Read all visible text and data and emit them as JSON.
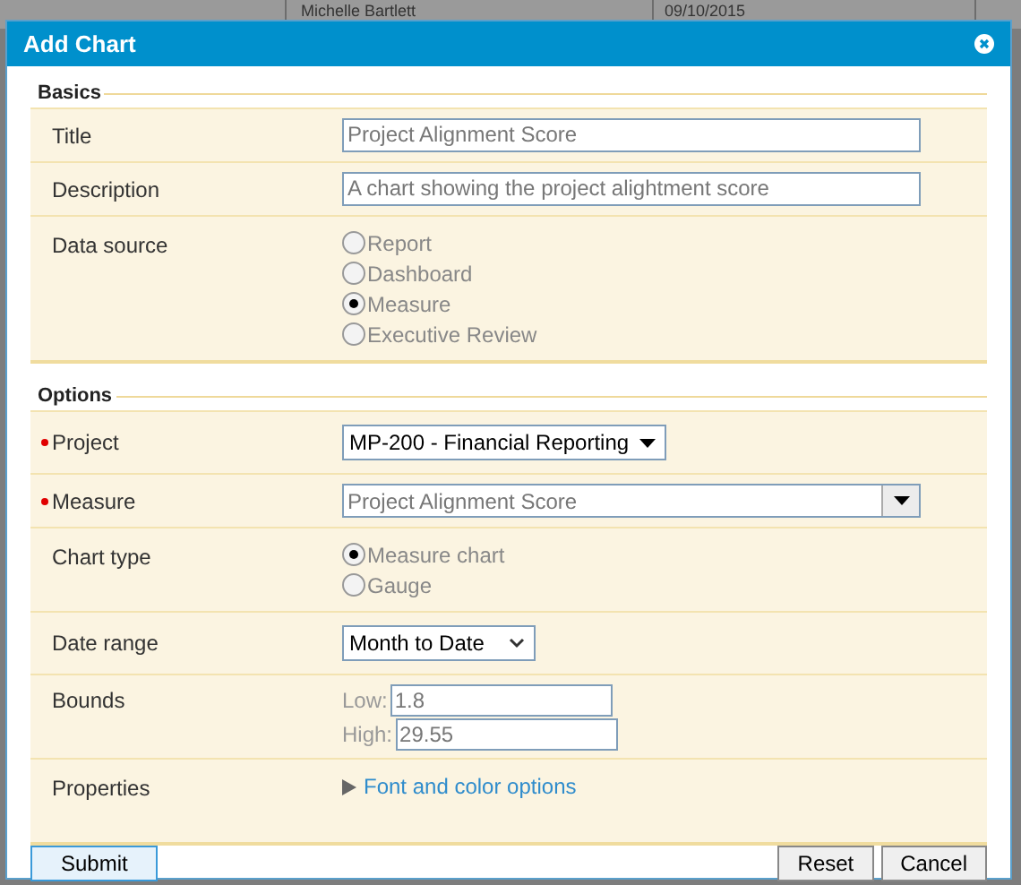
{
  "background_table": {
    "cells": [
      "Michelle Bartlett",
      "09/10/2015"
    ]
  },
  "dialog": {
    "title": "Add Chart"
  },
  "sections": [
    {
      "legend": "Basics",
      "rows": [
        {
          "kind": "text",
          "label": "Title",
          "required": false,
          "value": "Project Alignment Score"
        },
        {
          "kind": "text",
          "label": "Description",
          "required": false,
          "value": "A chart showing the project alightment score"
        },
        {
          "kind": "radio",
          "label": "Data source",
          "required": false,
          "options": [
            {
              "label": "Report",
              "selected": false
            },
            {
              "label": "Dashboard",
              "selected": false
            },
            {
              "label": "Measure",
              "selected": true
            },
            {
              "label": "Executive Review",
              "selected": false
            }
          ]
        }
      ]
    },
    {
      "legend": "Options",
      "rows": [
        {
          "kind": "select",
          "label": "Project",
          "required": true,
          "value": "MP-200 - Financial Reporting"
        },
        {
          "kind": "combo",
          "label": "Measure",
          "required": true,
          "value": "Project Alignment Score"
        },
        {
          "kind": "radio",
          "label": "Chart type",
          "required": false,
          "options": [
            {
              "label": "Measure chart",
              "selected": true
            },
            {
              "label": "Gauge",
              "selected": false
            }
          ]
        },
        {
          "kind": "dropdown",
          "label": "Date range",
          "required": false,
          "value": "Month to Date"
        },
        {
          "kind": "bounds",
          "label": "Bounds",
          "required": false,
          "fields": [
            {
              "label": "Low:",
              "value": "1.8"
            },
            {
              "label": "High:",
              "value": "29.55"
            }
          ]
        },
        {
          "kind": "link",
          "label": "Properties",
          "required": false,
          "value": "Font and color options"
        }
      ]
    }
  ],
  "buttons": {
    "left": [
      "Submit"
    ],
    "right": [
      "Reset",
      "Cancel"
    ]
  }
}
